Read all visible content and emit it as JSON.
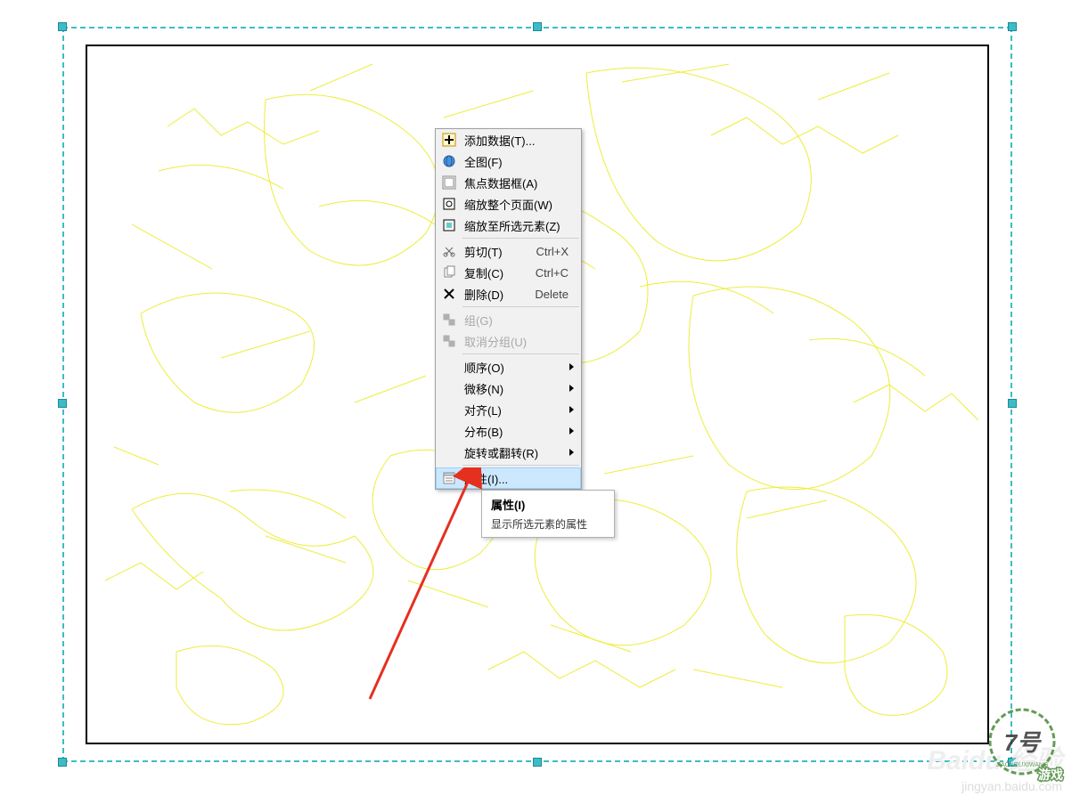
{
  "menu": {
    "items": [
      {
        "label": "添加数据(T)...",
        "icon": "add-data-icon"
      },
      {
        "label": "全图(F)",
        "icon": "globe-icon"
      },
      {
        "label": "焦点数据框(A)",
        "icon": "focus-frame-icon"
      },
      {
        "label": "缩放整个页面(W)",
        "icon": "zoom-page-icon"
      },
      {
        "label": "缩放至所选元素(Z)",
        "icon": "zoom-sel-icon"
      }
    ],
    "edit": [
      {
        "label": "剪切(T)",
        "shortcut": "Ctrl+X",
        "icon": "cut-icon"
      },
      {
        "label": "复制(C)",
        "shortcut": "Ctrl+C",
        "icon": "copy-icon"
      },
      {
        "label": "删除(D)",
        "shortcut": "Delete",
        "icon": "delete-icon"
      }
    ],
    "group": [
      {
        "label": "组(G)",
        "icon": "group-icon",
        "disabled": true
      },
      {
        "label": "取消分组(U)",
        "icon": "ungroup-icon",
        "disabled": true
      }
    ],
    "arrange": [
      {
        "label": "顺序(O)",
        "sub": true
      },
      {
        "label": "微移(N)",
        "sub": true
      },
      {
        "label": "对齐(L)",
        "sub": true
      },
      {
        "label": "分布(B)",
        "sub": true
      },
      {
        "label": "旋转或翻转(R)",
        "sub": true
      }
    ],
    "props": {
      "label": "属性(I)...",
      "icon": "properties-icon"
    }
  },
  "tooltip": {
    "title": "属性(I)",
    "desc": "显示所选元素的属性"
  },
  "watermark": {
    "brand": "Baidu 经验",
    "url": "jingyan.baidu.com",
    "logo_main": "7号",
    "logo_sub": "游戏",
    "logo_domain": "JIAOYOUXIWANG"
  }
}
